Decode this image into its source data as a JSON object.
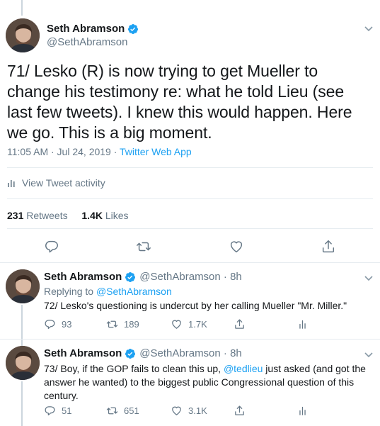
{
  "main_tweet": {
    "display_name": "Seth Abramson",
    "handle": "@SethAbramson",
    "text": "71/ Lesko (R) is now trying to get Mueller to change his testimony re: what he told Lieu (see last few tweets). I knew this would happen. Here we go. This is a big moment.",
    "timestamp": "11:05 AM · Jul 24, 2019 · ",
    "source": "Twitter Web App",
    "activity_label": "View Tweet activity",
    "retweets_count": "231",
    "retweets_label": " Retweets",
    "likes_count": "1.4K",
    "likes_label": " Likes",
    "actions": [
      "reply-icon",
      "retweet-icon",
      "like-icon",
      "share-icon"
    ]
  },
  "replies": [
    {
      "display_name": "Seth Abramson",
      "handle_time": "@SethAbramson · 8h",
      "replying_prefix": "Replying to ",
      "replying_handle": "@SethAbramson",
      "text": "72/ Lesko's questioning is undercut by her calling Mueller \"Mr. Miller.\"",
      "reply_count": "93",
      "retweet_count": "189",
      "like_count": "1.7K"
    },
    {
      "display_name": "Seth Abramson",
      "handle_time": "@SethAbramson · 8h",
      "text_before": "73/ Boy, if the GOP fails to clean this up, ",
      "mention": "@tedlieu",
      "text_after": " just asked (and got the answer he wanted) to the biggest public Congressional question of this century.",
      "reply_count": "51",
      "retweet_count": "651",
      "like_count": "3.1K"
    }
  ],
  "colors": {
    "accent": "#1da1f2",
    "text": "#14171a",
    "muted": "#657786",
    "divider": "#e6ecf0"
  }
}
